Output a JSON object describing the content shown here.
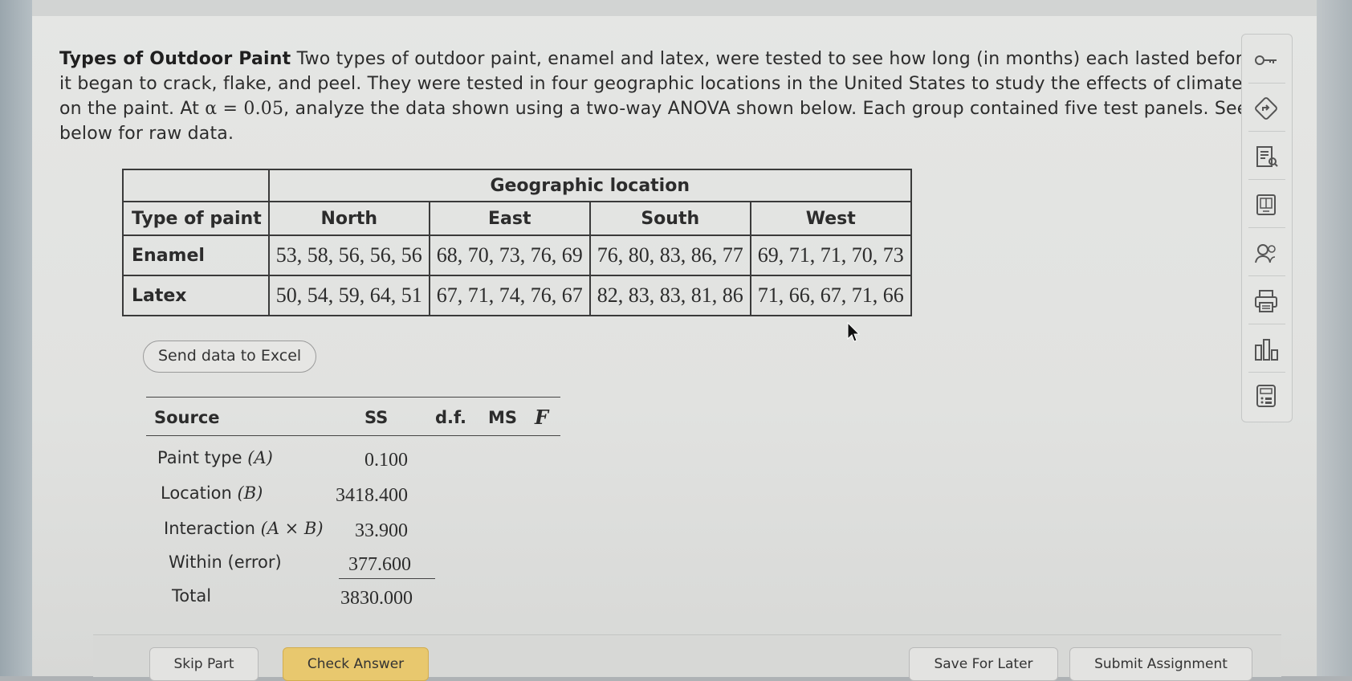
{
  "problem": {
    "title": "Types of Outdoor Paint",
    "text_part1": " Two types of outdoor paint, enamel and latex, were tested to see how long (in months) each lasted before it began to crack, flake, and peel. They were tested in four geographic locations in the United States to study the effects of climate on the paint. At ",
    "alpha_expr": "α = 0.05",
    "text_part2": ", analyze the data shown using a two-way ANOVA shown below. Each group contained five test panels. See below for raw data."
  },
  "data_table": {
    "group_header": "Geographic location",
    "row_header": "Type of paint",
    "columns": [
      "North",
      "East",
      "South",
      "West"
    ],
    "rows": [
      {
        "label": "Enamel",
        "cells": [
          "53, 58, 56, 56, 56",
          "68, 70, 73, 76, 69",
          "76, 80, 83, 86, 77",
          "69, 71, 71, 70, 73"
        ]
      },
      {
        "label": "Latex",
        "cells": [
          "50, 54, 59, 64, 51",
          "67, 71, 74, 76, 67",
          "82, 83, 83, 81, 86",
          "71, 66, 67, 71, 66"
        ]
      }
    ]
  },
  "excel_button": "Send data to Excel",
  "anova": {
    "headers": {
      "source": "Source",
      "ss": "SS",
      "df": "d.f.",
      "ms": "MS",
      "f": "F"
    },
    "rows": [
      {
        "source": "Paint type",
        "math": "(A)",
        "ss": "0.100"
      },
      {
        "source": "Location",
        "math": "(B)",
        "ss": "3418.400"
      },
      {
        "source": "Interaction",
        "math": "(A × B)",
        "ss": "33.900"
      },
      {
        "source": "Within (error)",
        "math": "",
        "ss": "377.600"
      },
      {
        "source": "Total",
        "math": "",
        "ss": "3830.000"
      }
    ]
  },
  "sidebar_icons": [
    "key-icon",
    "navigate-icon",
    "textbook-icon",
    "book-icon",
    "ask-instructor-icon",
    "print-icon",
    "statistics-icon",
    "calculator-icon"
  ],
  "footer": {
    "skip": "Skip Part",
    "check": "Check Answer",
    "save": "Save For Later",
    "submit": "Submit Assignment"
  },
  "colors": {
    "check_button": "#e8c86e",
    "page_bg": "#e3e4e2"
  }
}
